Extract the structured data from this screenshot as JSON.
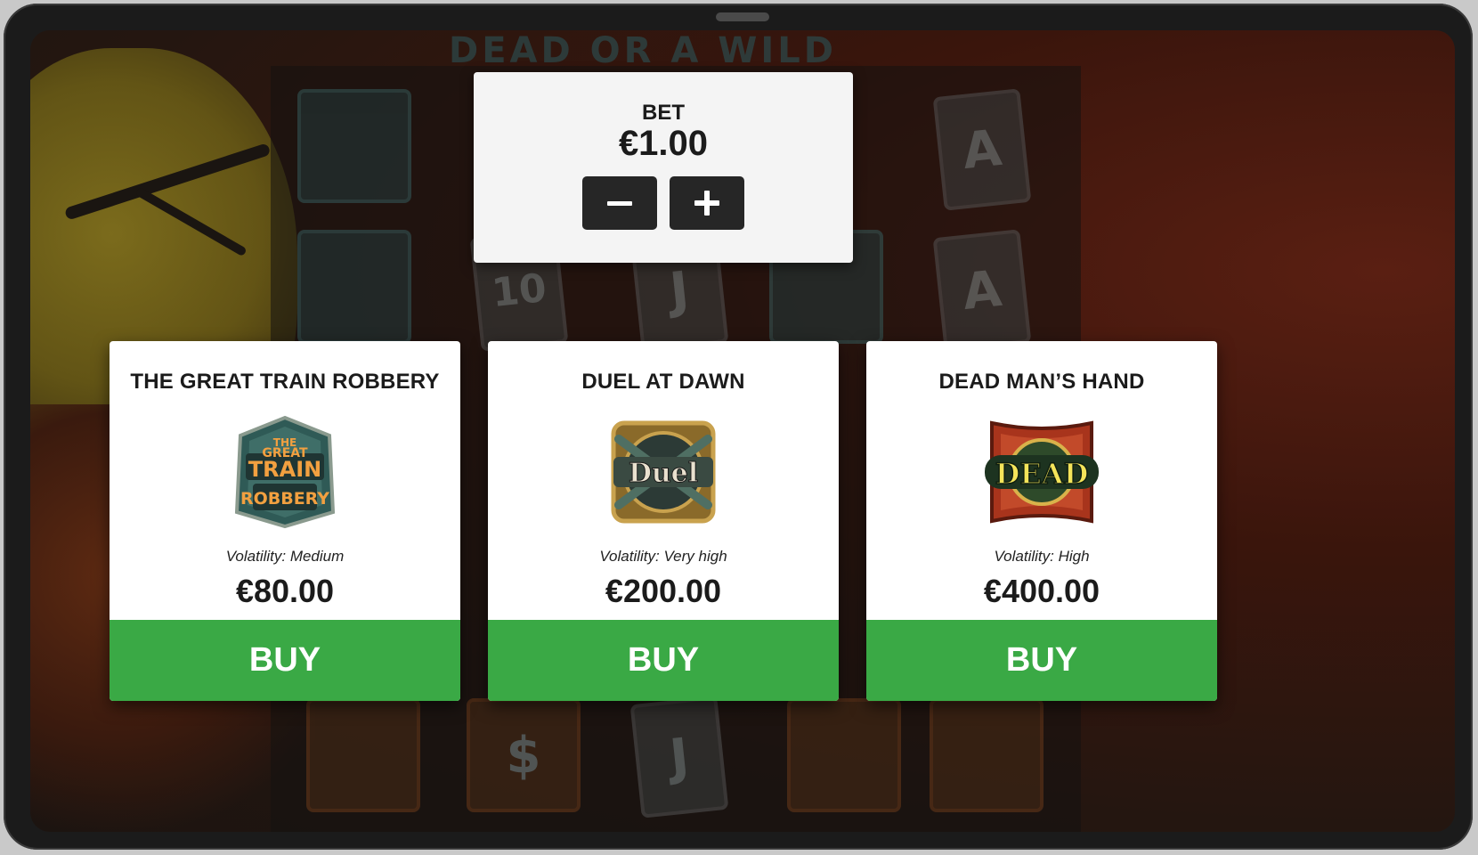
{
  "game": {
    "title": "DEAD OR A WILD"
  },
  "bet_panel": {
    "label": "BET",
    "value": "€1.00",
    "decrease_icon": "minus-icon",
    "increase_icon": "plus-icon"
  },
  "features": [
    {
      "title": "THE GREAT TRAIN ROBBERY",
      "logo_text": [
        "THE",
        "GREAT",
        "TRAIN",
        "ROBBERY"
      ],
      "volatility": "Volatility: Medium",
      "price": "€80.00",
      "buy_label": "BUY"
    },
    {
      "title": "DUEL AT DAWN",
      "logo_text": [
        "Duel"
      ],
      "volatility": "Volatility: Very high",
      "price": "€200.00",
      "buy_label": "BUY"
    },
    {
      "title": "DEAD MAN’S HAND",
      "logo_text": [
        "DEAD"
      ],
      "volatility": "Volatility: High",
      "price": "€400.00",
      "buy_label": "BUY"
    }
  ],
  "background_symbols": [
    "A",
    "A",
    "10",
    "J",
    "J",
    "$"
  ],
  "colors": {
    "buy_green": "#3aa945",
    "panel_bg": "#f4f4f4",
    "button_dark": "#262626"
  }
}
